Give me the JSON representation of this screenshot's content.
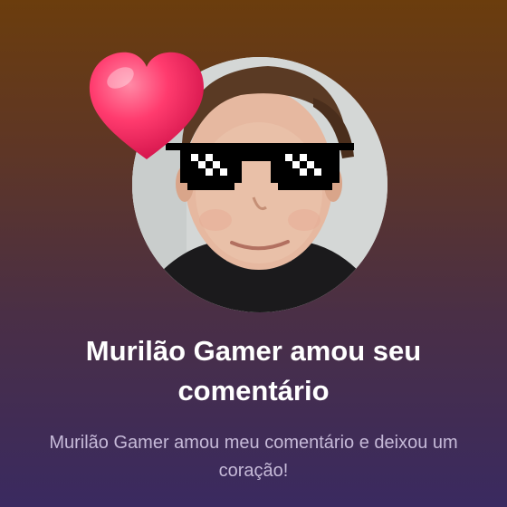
{
  "notification": {
    "title": "Murilão Gamer amou seu comentário",
    "message": "Murilão Gamer amou meu comentário e deixou um coração!"
  },
  "icons": {
    "reaction": "heart-icon",
    "accessory": "pixel-sunglasses"
  },
  "colors": {
    "title": "#ffffff",
    "message": "#c6bad8",
    "heart": "#ff2d63",
    "background_top": "#6b3d0d",
    "background_bottom": "#3a2a60"
  }
}
